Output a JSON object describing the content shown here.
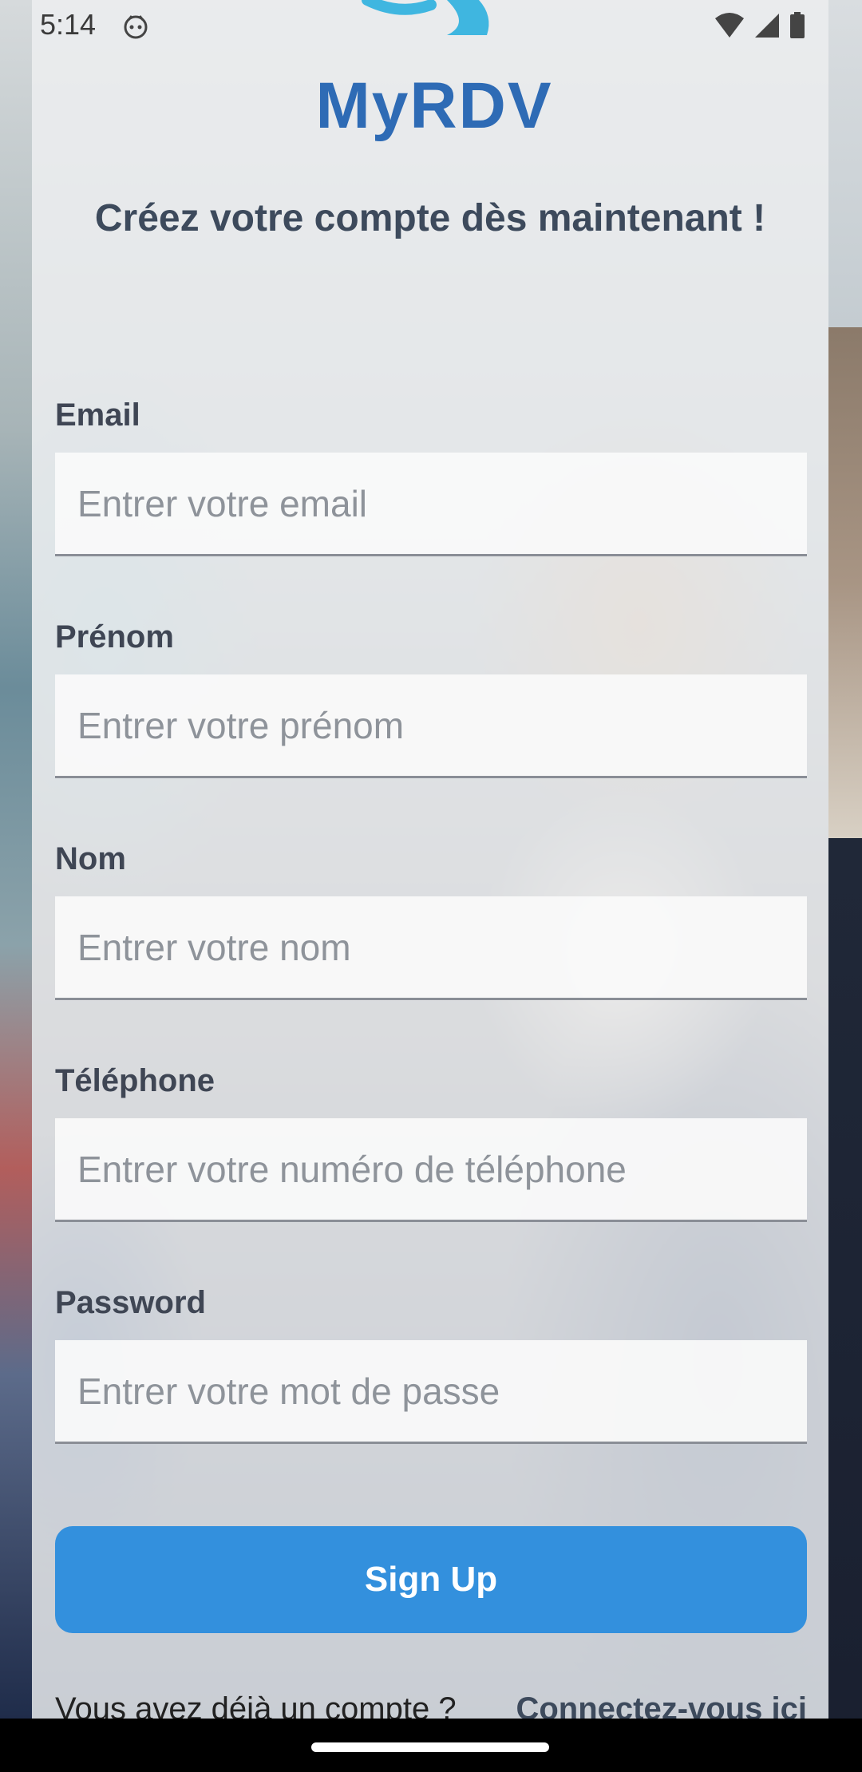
{
  "status_bar": {
    "time": "5:14",
    "icons": [
      "app-notification-icon",
      "wifi-icon",
      "signal-icon",
      "battery-icon"
    ]
  },
  "app": {
    "logo_text": "MyRDV",
    "headline": "Créez votre compte dès maintenant !"
  },
  "form": {
    "email": {
      "label": "Email",
      "placeholder": "Entrer votre email",
      "value": ""
    },
    "first_name": {
      "label": "Prénom",
      "placeholder": "Entrer votre prénom",
      "value": ""
    },
    "last_name": {
      "label": "Nom",
      "placeholder": "Entrer votre nom",
      "value": ""
    },
    "phone": {
      "label": "Téléphone",
      "placeholder": "Entrer votre numéro de téléphone",
      "value": ""
    },
    "password": {
      "label": "Password",
      "placeholder": "Entrer votre mot de passe",
      "value": ""
    },
    "submit_label": "Sign Up"
  },
  "footer": {
    "account_text": "Vous avez déjà un compte ?",
    "login_link": "Connectez-vous ici"
  },
  "colors": {
    "brand_blue": "#2e6bb5",
    "button_blue": "#3390dd",
    "headline": "#3d4a5c"
  }
}
